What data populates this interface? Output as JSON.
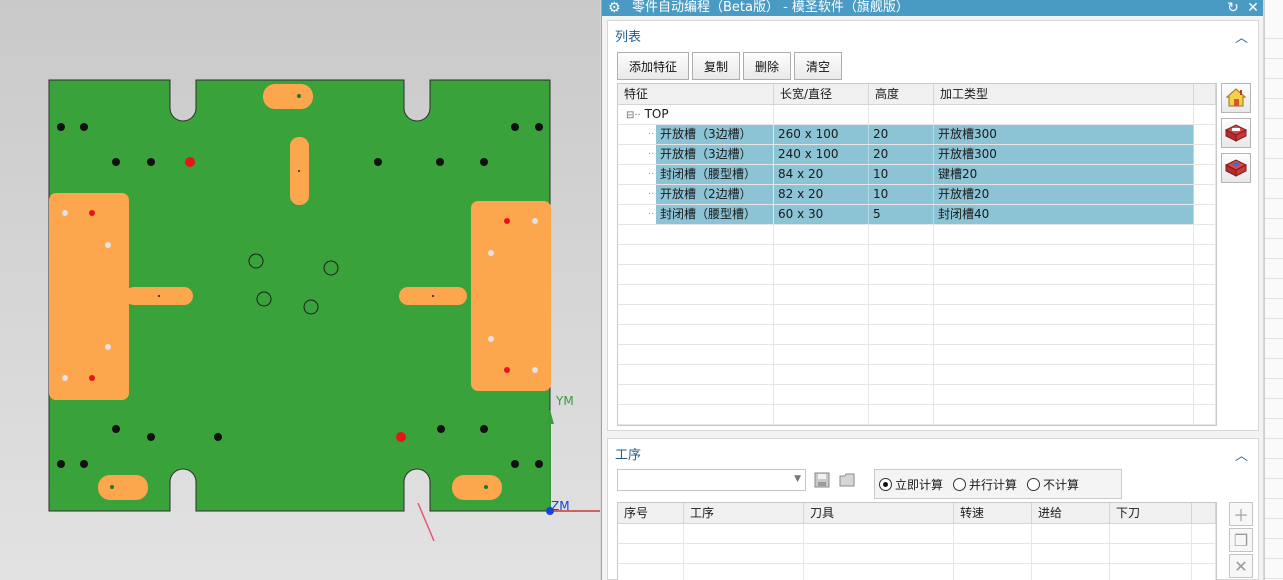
{
  "viewport": {
    "axis_y_label": "YM",
    "axis_z_label": "ZM",
    "colors": {
      "plate": "#39a23b",
      "pocket": "#fca64d",
      "hole_black": "#111111",
      "hole_red": "#e8141a",
      "hole_white": "#e2e2e2"
    }
  },
  "dialog": {
    "title": "零件自动编程（Beta版） - 模圣软件（旗舰版）",
    "title_icons": [
      "gear-icon",
      "refresh-icon",
      "close-icon"
    ],
    "accent": "#4a9bc3"
  },
  "list_section": {
    "title": "列表",
    "buttons": {
      "add": "添加特征",
      "copy": "复制",
      "delete": "删除",
      "clear": "清空"
    },
    "columns": [
      "特征",
      "长宽/直径",
      "高度",
      "加工类型"
    ],
    "root": "TOP",
    "rows": [
      {
        "feature": "开放槽（3边槽）",
        "size": "260 x 100",
        "height": "20",
        "type": "开放槽300"
      },
      {
        "feature": "开放槽（3边槽）",
        "size": "240 x 100",
        "height": "20",
        "type": "开放槽300"
      },
      {
        "feature": "封闭槽（腰型槽）",
        "size": "84 x 20",
        "height": "10",
        "type": "键槽20"
      },
      {
        "feature": "开放槽（2边槽）",
        "size": "82 x 20",
        "height": "10",
        "type": "开放槽20"
      },
      {
        "feature": "封闭槽（腰型槽）",
        "size": "60 x 30",
        "height": "5",
        "type": "封闭槽40"
      }
    ],
    "side_icons": [
      "house-icon",
      "box-slot-icon",
      "box-pocket-icon"
    ]
  },
  "process_section": {
    "title": "工序",
    "combo_value": "",
    "calc_options": [
      "立即计算",
      "并行计算",
      "不计算"
    ],
    "calc_selected": 0,
    "columns": [
      "序号",
      "工序",
      "刀具",
      "转速",
      "进给",
      "下刀"
    ],
    "side_icons": [
      "add-icon",
      "copy-icon",
      "delete-icon"
    ]
  }
}
